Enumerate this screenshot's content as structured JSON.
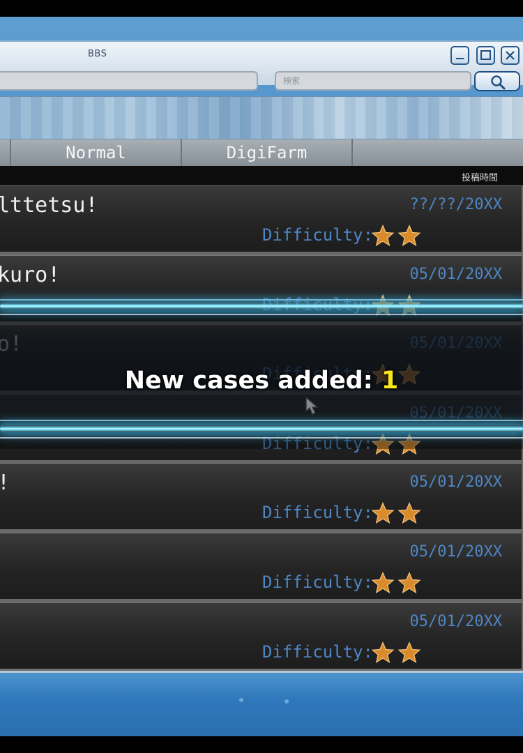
{
  "window": {
    "title": "BBS",
    "search_placeholder": "検索"
  },
  "tabs": [
    "",
    "Normal",
    "DigiFarm",
    ""
  ],
  "list_header": "投稿時間",
  "difficulty_label": "Difficulty:",
  "posts": [
    {
      "title": "lttetsu!",
      "date": "??/??/20XX",
      "stars": 2
    },
    {
      "title": "kuro!",
      "date": "05/01/20XX",
      "stars": 2
    },
    {
      "title": "o!",
      "date": "05/01/20XX",
      "stars": 2
    },
    {
      "title": "",
      "date": "05/01/20XX",
      "stars": 2
    },
    {
      "title": "!",
      "date": "05/01/20XX",
      "stars": 2
    },
    {
      "title": "",
      "date": "05/01/20XX",
      "stars": 2
    },
    {
      "title": "",
      "date": "05/01/20XX",
      "stars": 2
    }
  ],
  "notice": {
    "label": "New cases added:",
    "count": "1"
  },
  "colors": {
    "accent_blue": "#4f86c4",
    "beam_cyan": "#6fe2ff",
    "count_yellow": "#f7e61c",
    "star_orange": "#d98a2b"
  }
}
